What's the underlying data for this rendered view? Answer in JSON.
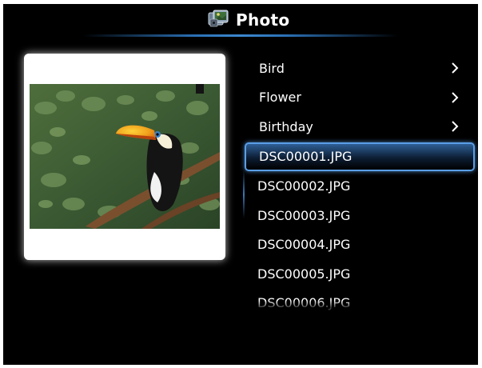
{
  "header": {
    "title": "Photo",
    "icon": "photo-app-icon"
  },
  "preview": {
    "subject": "toucan-photo"
  },
  "list": {
    "folders": [
      {
        "label": "Bird",
        "icon": "chevron-right-icon"
      },
      {
        "label": "Flower",
        "icon": "chevron-right-icon"
      },
      {
        "label": "Birthday",
        "icon": "chevron-right-icon"
      }
    ],
    "files": [
      {
        "label": "DSC00001.JPG",
        "selected": true
      },
      {
        "label": "DSC00002.JPG",
        "selected": false
      },
      {
        "label": "DSC00003.JPG",
        "selected": false
      },
      {
        "label": "DSC00004.JPG",
        "selected": false
      },
      {
        "label": "DSC00005.JPG",
        "selected": false
      },
      {
        "label": "DSC00006.JPG",
        "selected": false
      }
    ]
  },
  "colors": {
    "background": "#000000",
    "accent": "#5a9ee6",
    "text": "#ffffff"
  }
}
